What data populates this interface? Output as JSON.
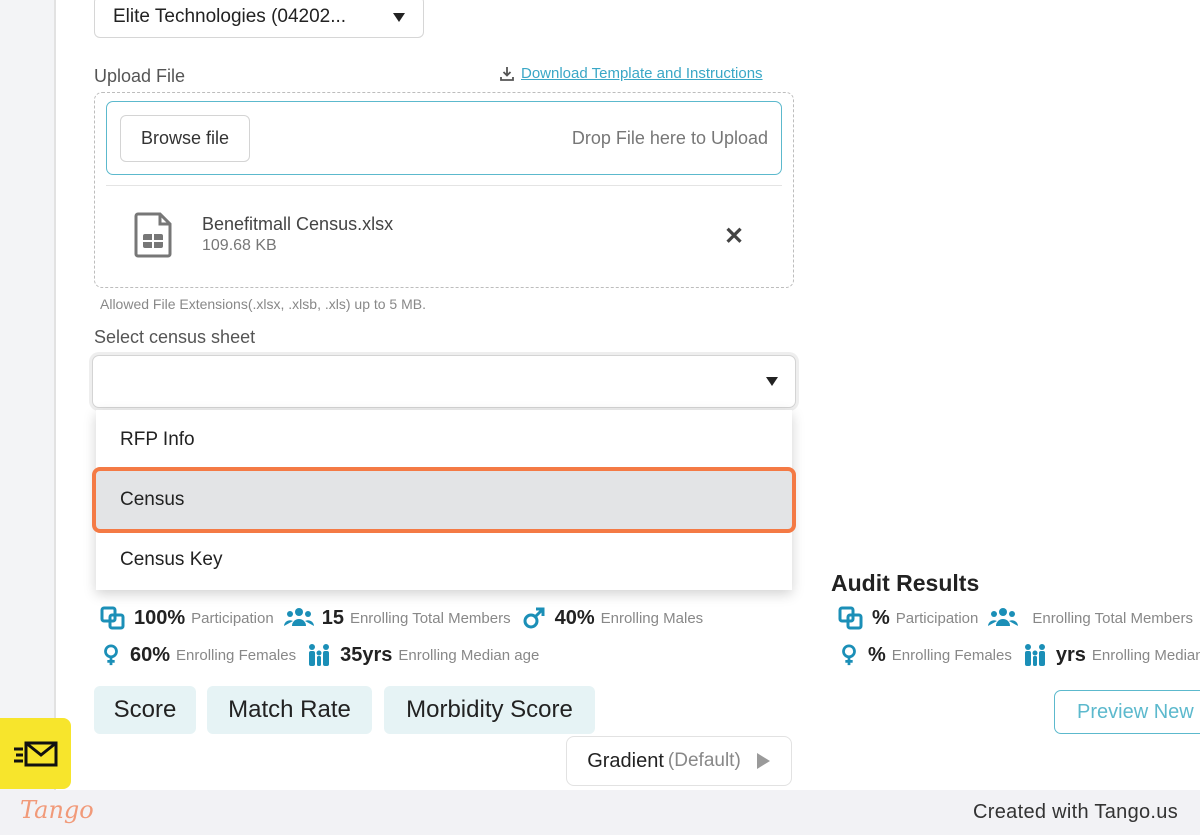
{
  "company_select": {
    "value": "Elite Technologies (04202..."
  },
  "upload": {
    "label": "Upload File",
    "download_link": "Download Template and Instructions",
    "browse_button": "Browse file",
    "drop_text": "Drop File here to Upload",
    "file": {
      "name": "Benefitmall Census.xlsx",
      "size": "109.68 KB"
    },
    "allowed_text": "Allowed File Extensions(.xlsx, .xlsb, .xls) up to 5 MB."
  },
  "census_sheet": {
    "label": "Select census sheet",
    "value": "",
    "options": [
      "RFP Info",
      "Census",
      "Census Key"
    ],
    "selected": "Census"
  },
  "census_stats": {
    "participation_value": "100%",
    "participation_label": "Participation",
    "members_value": "15",
    "members_label": "Enrolling Total Members",
    "males_value": "40%",
    "males_label": "Enrolling Males",
    "females_value": "60%",
    "females_label": "Enrolling Females",
    "age_value": "35yrs",
    "age_label": "Enrolling Median age"
  },
  "audit": {
    "title": "Audit Results",
    "participation_value": "%",
    "participation_label": "Participation",
    "members_label": "Enrolling Total Members",
    "females_value": "%",
    "females_label": "Enrolling Females",
    "age_value": "yrs",
    "age_label": "Enrolling Median"
  },
  "chips": [
    "Score",
    "Match Rate",
    "Morbidity Score"
  ],
  "gradient": {
    "label": "Gradient",
    "default_label": "(Default)"
  },
  "preview_button": "Preview New",
  "footer": {
    "logo": "Tango",
    "created": "Created with Tango.us"
  },
  "colors": {
    "accent": "#5cb9cd",
    "highlight": "#f47a45",
    "icon": "#1b8fb7",
    "tango_yellow": "#f7e52c"
  }
}
